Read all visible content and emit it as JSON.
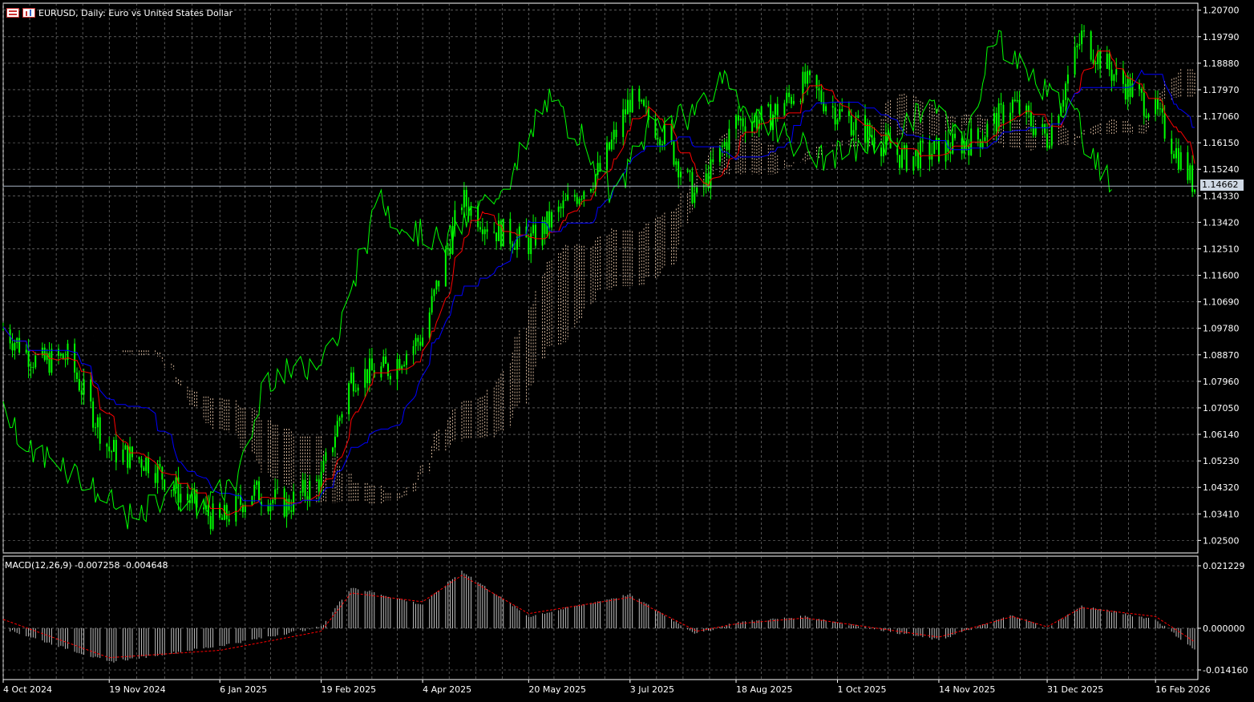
{
  "header": {
    "grid_icon": "chart-window-icon",
    "bars_icon": "chart-bars-icon",
    "title": "EURUSD, Daily:  Euro vs United States Dollar"
  },
  "current_price": "1.14662",
  "macd_label": "MACD(12,26,9) -0.007258 -0.004648",
  "colors": {
    "background": "#000000",
    "grid": "#8c8c8c",
    "candle": "#00ff00",
    "tenkan": "#ff0000",
    "kijun": "#0000ff",
    "chikou": "#00ff00",
    "kumo": "#ffdab9",
    "macd_hist": "#c0c0c0",
    "macd_signal": "#ff0000"
  },
  "chart_data": [
    {
      "type": "line",
      "subtype": "candlestick-ichimoku",
      "title": "EURUSD, Daily:  Euro vs United States Dollar",
      "x_ticks": [
        "4 Oct 2024",
        "19 Nov 2024",
        "6 Jan 2025",
        "19 Feb 2025",
        "4 Apr 2025",
        "20 May 2025",
        "3 Jul 2025",
        "18 Aug 2025",
        "1 Oct 2025",
        "14 Nov 2025",
        "31 Dec 2025",
        "16 Feb 2026"
      ],
      "y_ticks": [
        "1.20700",
        "1.19790",
        "1.18880",
        "1.17970",
        "1.17060",
        "1.16150",
        "1.15240",
        "1.14330",
        "1.13420",
        "1.12510",
        "1.11600",
        "1.10690",
        "1.09780",
        "1.08870",
        "1.07960",
        "1.07050",
        "1.06140",
        "1.05230",
        "1.04320",
        "1.03410",
        "1.02500"
      ],
      "ylim": [
        1.0207,
        1.2094
      ],
      "grid": true,
      "close": [
        {
          "x": "4 Oct 2024",
          "y": 1.0975
        },
        {
          "x": "19 Oct 2024",
          "y": 1.086
        },
        {
          "x": "1 Nov 2024",
          "y": 1.088
        },
        {
          "x": "19 Nov 2024",
          "y": 1.056
        },
        {
          "x": "6 Dec 2024",
          "y": 1.052
        },
        {
          "x": "20 Dec 2024",
          "y": 1.041
        },
        {
          "x": "6 Jan 2025",
          "y": 1.031
        },
        {
          "x": "20 Jan 2025",
          "y": 1.042
        },
        {
          "x": "4 Feb 2025",
          "y": 1.037
        },
        {
          "x": "19 Feb 2025",
          "y": 1.046
        },
        {
          "x": "4 Mar 2025",
          "y": 1.081
        },
        {
          "x": "20 Mar 2025",
          "y": 1.084
        },
        {
          "x": "4 Apr 2025",
          "y": 1.095
        },
        {
          "x": "21 Apr 2025",
          "y": 1.142
        },
        {
          "x": "4 May 2025",
          "y": 1.132
        },
        {
          "x": "20 May 2025",
          "y": 1.127
        },
        {
          "x": "5 Jun 2025",
          "y": 1.14
        },
        {
          "x": "20 Jun 2025",
          "y": 1.152
        },
        {
          "x": "3 Jul 2025",
          "y": 1.176
        },
        {
          "x": "18 Jul 2025",
          "y": 1.164
        },
        {
          "x": "1 Aug 2025",
          "y": 1.142
        },
        {
          "x": "18 Aug 2025",
          "y": 1.169
        },
        {
          "x": "1 Sep 2025",
          "y": 1.17
        },
        {
          "x": "17 Sep 2025",
          "y": 1.182
        },
        {
          "x": "1 Oct 2025",
          "y": 1.172
        },
        {
          "x": "16 Oct 2025",
          "y": 1.164
        },
        {
          "x": "30 Oct 2025",
          "y": 1.156
        },
        {
          "x": "14 Nov 2025",
          "y": 1.159
        },
        {
          "x": "1 Dec 2025",
          "y": 1.163
        },
        {
          "x": "16 Dec 2025",
          "y": 1.175
        },
        {
          "x": "31 Dec 2025",
          "y": 1.163
        },
        {
          "x": "15 Jan 2026",
          "y": 1.198
        },
        {
          "x": "30 Jan 2026",
          "y": 1.184
        },
        {
          "x": "16 Feb 2026",
          "y": 1.172
        },
        {
          "x": "5 Mar 2026",
          "y": 1.1466
        }
      ]
    },
    {
      "type": "bar",
      "title": "MACD(12,26,9) -0.007258 -0.004648",
      "y_ticks": [
        "0.021229",
        "0.000000",
        "-0.014160"
      ],
      "ylim": [
        -0.01416,
        0.021229
      ],
      "macd": [
        {
          "x": "4 Oct 2024",
          "y": 0.0
        },
        {
          "x": "19 Nov 2024",
          "y": -0.0115
        },
        {
          "x": "6 Jan 2025",
          "y": -0.006
        },
        {
          "x": "19 Feb 2025",
          "y": 0.0005
        },
        {
          "x": "4 Mar 2025",
          "y": 0.014
        },
        {
          "x": "4 Apr 2025",
          "y": 0.008
        },
        {
          "x": "21 Apr 2025",
          "y": 0.0195
        },
        {
          "x": "20 May 2025",
          "y": 0.004
        },
        {
          "x": "3 Jul 2025",
          "y": 0.0115
        },
        {
          "x": "1 Aug 2025",
          "y": -0.002
        },
        {
          "x": "18 Aug 2025",
          "y": 0.002
        },
        {
          "x": "17 Sep 2025",
          "y": 0.004
        },
        {
          "x": "14 Nov 2025",
          "y": -0.004
        },
        {
          "x": "16 Dec 2025",
          "y": 0.0045
        },
        {
          "x": "31 Dec 2025",
          "y": 0.0
        },
        {
          "x": "15 Jan 2026",
          "y": 0.0075
        },
        {
          "x": "16 Feb 2026",
          "y": 0.003
        },
        {
          "x": "5 Mar 2026",
          "y": -0.0073
        }
      ],
      "signal": [
        {
          "x": "4 Oct 2024",
          "y": 0.003
        },
        {
          "x": "19 Nov 2024",
          "y": -0.01
        },
        {
          "x": "6 Jan 2025",
          "y": -0.0075
        },
        {
          "x": "19 Feb 2025",
          "y": -0.001
        },
        {
          "x": "4 Mar 2025",
          "y": 0.012
        },
        {
          "x": "4 Apr 2025",
          "y": 0.009
        },
        {
          "x": "21 Apr 2025",
          "y": 0.018
        },
        {
          "x": "20 May 2025",
          "y": 0.005
        },
        {
          "x": "3 Jul 2025",
          "y": 0.0105
        },
        {
          "x": "1 Aug 2025",
          "y": -0.001
        },
        {
          "x": "18 Aug 2025",
          "y": 0.0015
        },
        {
          "x": "17 Sep 2025",
          "y": 0.0035
        },
        {
          "x": "14 Nov 2025",
          "y": -0.003
        },
        {
          "x": "16 Dec 2025",
          "y": 0.004
        },
        {
          "x": "31 Dec 2025",
          "y": 0.0005
        },
        {
          "x": "15 Jan 2026",
          "y": 0.007
        },
        {
          "x": "16 Feb 2026",
          "y": 0.004
        },
        {
          "x": "5 Mar 2026",
          "y": -0.0046
        }
      ]
    }
  ]
}
